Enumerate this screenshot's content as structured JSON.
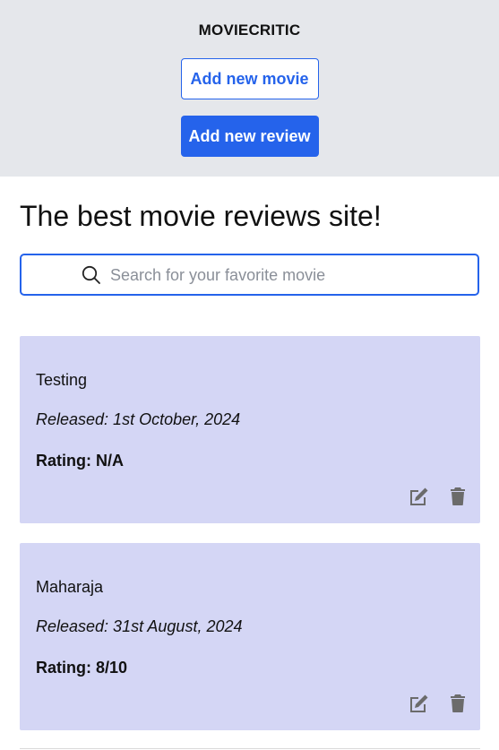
{
  "header": {
    "brand": "MOVIECRITIC",
    "add_movie_label": "Add new movie",
    "add_review_label": "Add new review"
  },
  "main": {
    "title": "The best movie reviews site!",
    "search": {
      "placeholder": "Search for your favorite movie",
      "value": ""
    }
  },
  "movies": [
    {
      "title": "Testing",
      "released": "Released: 1st October, 2024",
      "rating": "Rating: N/A",
      "edit_icon": "edit-icon",
      "delete_icon": "trash-icon"
    },
    {
      "title": "Maharaja",
      "released": "Released: 31st August, 2024",
      "rating": "Rating: 8/10",
      "edit_icon": "edit-icon",
      "delete_icon": "trash-icon"
    }
  ],
  "colors": {
    "accent": "#2563eb",
    "header_bg": "#e5e7eb",
    "card_bg": "#d4d6f5",
    "icon_gray": "#6b6b6b"
  }
}
